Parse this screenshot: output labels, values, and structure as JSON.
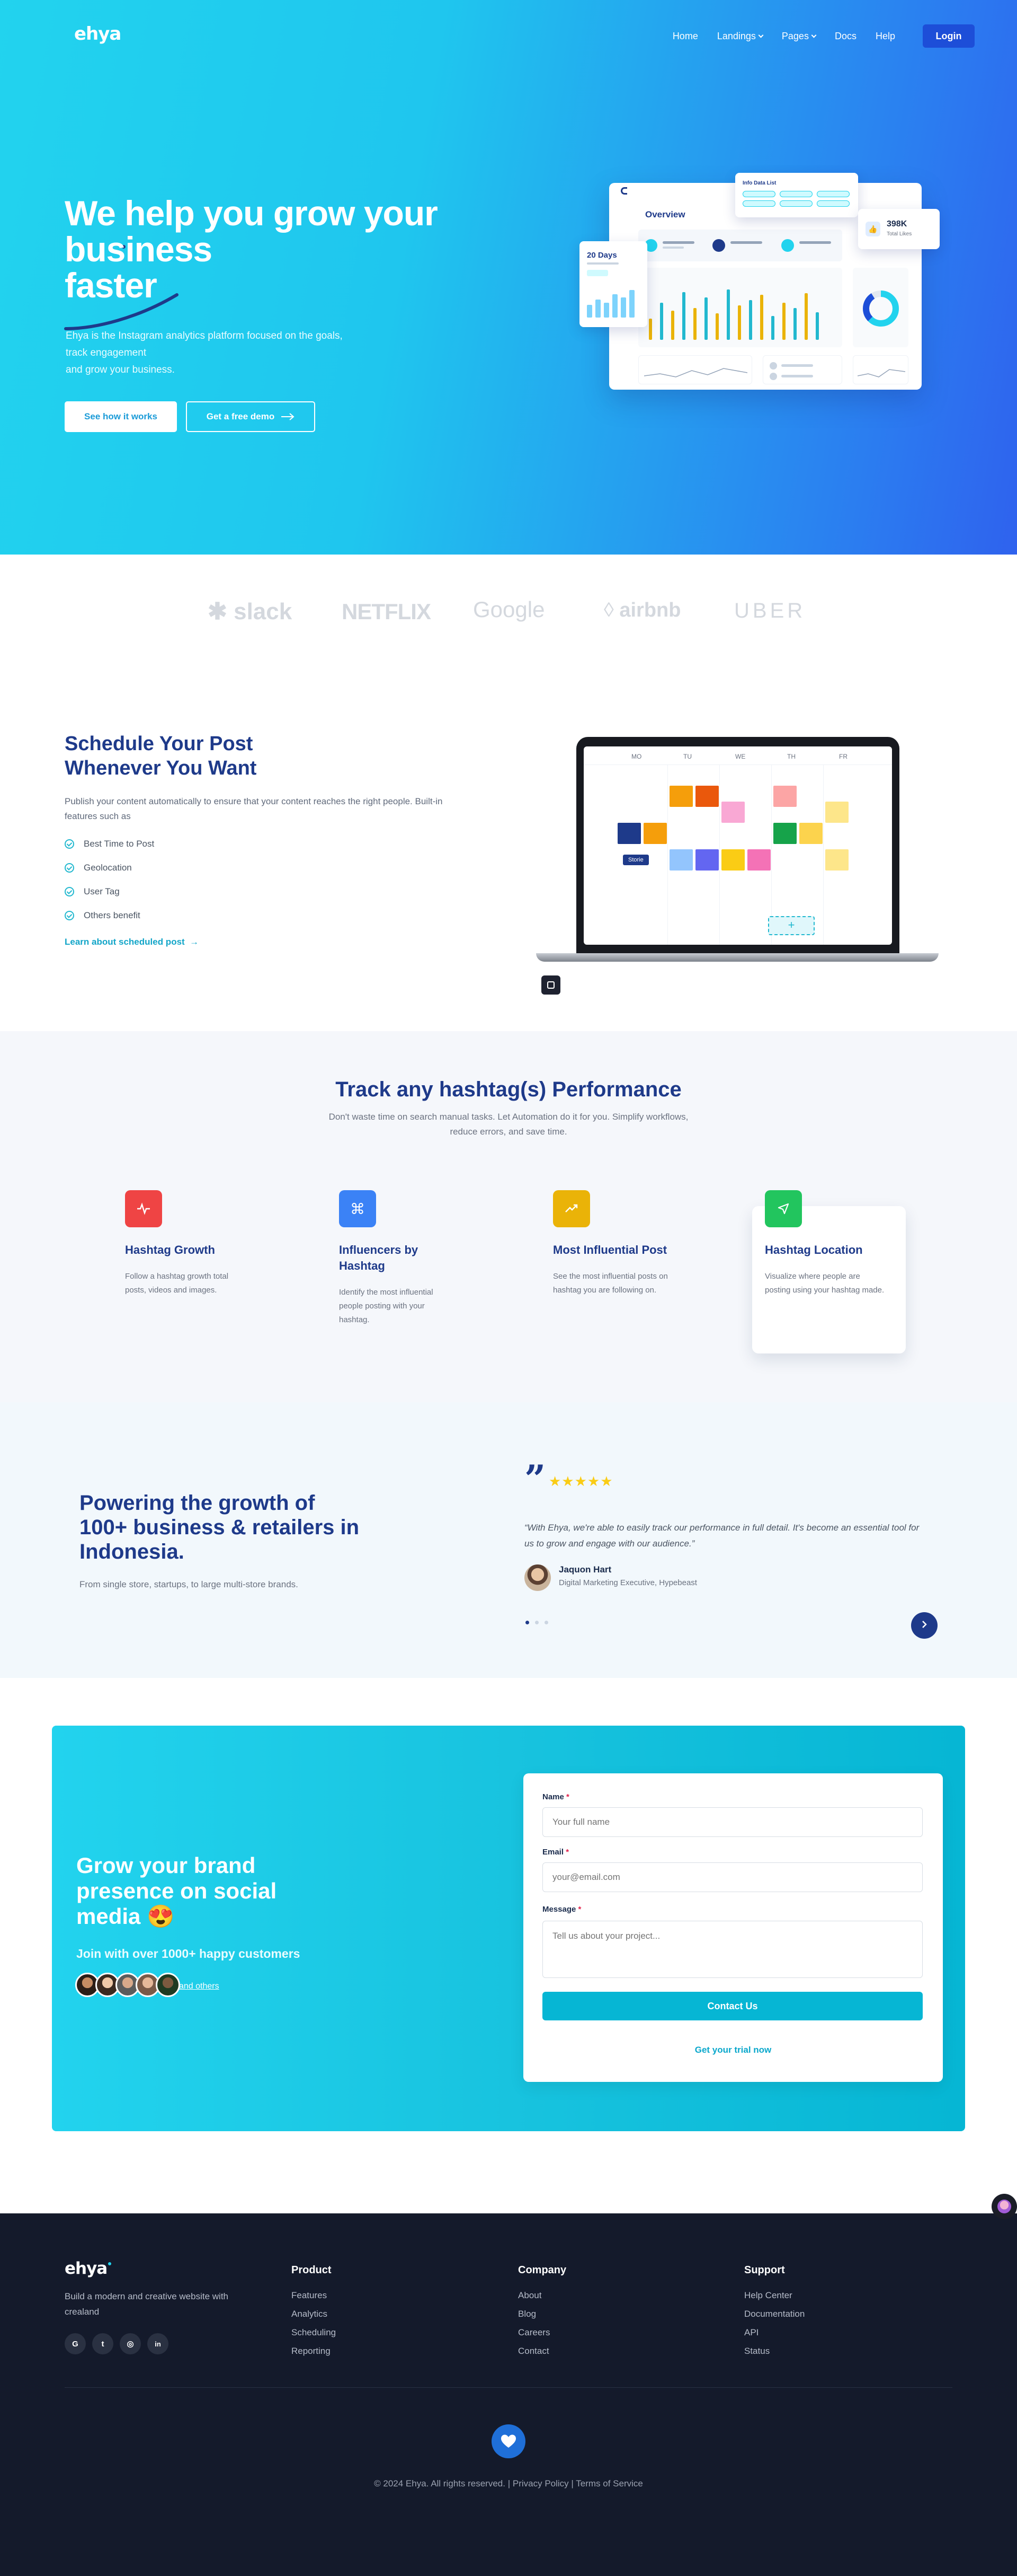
{
  "header": {
    "logo": "ehya",
    "nav": [
      {
        "label": "Home"
      },
      {
        "label": "Landings"
      },
      {
        "label": "Pages"
      },
      {
        "label": "Docs"
      },
      {
        "label": "Help"
      }
    ],
    "login_label": "Login"
  },
  "hero": {
    "title_line1": "We help you grow your",
    "title_line2": "business",
    "title_line3": "faster",
    "desc_line1": "Ehya is the Instagram analytics platform focused on the goals,",
    "desc_line2": "track engagement",
    "desc_line3": "and grow your business.",
    "primary_cta": "See how it works",
    "secondary_cta": "Get a free demo",
    "dashboard": {
      "overview_label": "Overview",
      "days_label": "20 Days",
      "stat_value": "398K",
      "stat_caption": "Total Likes",
      "popup_title": "Info Data List"
    },
    "colors": {
      "gradient_start": "#22d3ee",
      "gradient_end": "#2f62ee",
      "accent": "#1d4ed8"
    }
  },
  "brands": [
    "slack",
    "NETFLIX",
    "Google",
    "airbnb",
    "UBER"
  ],
  "schedule": {
    "title_line1": "Schedule Your Post",
    "title_line2": "Whenever You Want",
    "desc_line1": "Publish your content automatically to ensure that your content reaches the right people. Built-in",
    "desc_line2": "features such as",
    "features": [
      "Best Time to Post",
      "Geolocation",
      "User Tag",
      "Others benefit"
    ],
    "link": "Learn about scheduled post",
    "calendar": {
      "days": [
        "MO",
        "TU",
        "WE",
        "TH",
        "FR"
      ],
      "story_label": "Storie",
      "add_symbol": "+"
    }
  },
  "hashtag": {
    "title": "Track any hashtag(s) Performance",
    "sub_line1": "Don't waste time on search manual tasks. Let Automation do it for you. Simplify workflows,",
    "sub_line2": "reduce errors, and save time.",
    "cards": [
      {
        "title": "Hashtag Growth",
        "desc_lines": [
          "Follow a hashtag growth total",
          "posts, videos and images."
        ],
        "color": "#ef4444"
      },
      {
        "title_lines": [
          "Influencers by",
          "Hashtag"
        ],
        "desc_lines": [
          "Identify the most influential",
          "people posting with your",
          "hashtag."
        ],
        "color": "#3b82f6"
      },
      {
        "title": "Most Influential Post",
        "desc_lines": [
          "See the most influential posts on",
          "hashtag you are following on."
        ],
        "color": "#eab308"
      },
      {
        "title": "Hashtag Location",
        "desc_lines": [
          "Visualize where people are",
          "posting using your hashtag made."
        ],
        "color": "#22c55e"
      }
    ]
  },
  "testimonial": {
    "title_line1": "Powering the growth of",
    "title_line2": "100+ business & retailers in",
    "title_line3": "Indonesia.",
    "sub": "From single store, startups, to large multi-store brands.",
    "quote_mark": "”",
    "stars": "★★★★★",
    "rating": 5,
    "quote_line1": "“With Ehya, we're able to easily track our performance in full detail. It's become an essential tool for",
    "quote_line2": "us to grow and engage with our audience.”",
    "name": "Jaquon Hart",
    "role": "Digital Marketing Executive, Hypebeast"
  },
  "contact": {
    "title_line1": "Grow your brand",
    "title_line2": "presence on social",
    "title_line3": "media",
    "emoji": "😍",
    "join": "Join with over 1000+ happy customers",
    "others_link": "and others",
    "form": {
      "name_label": "Name",
      "name_placeholder": "Your full name",
      "email_label": "Email",
      "email_placeholder": "your@email.com",
      "message_label": "Message",
      "message_placeholder": "Tell us about your project...",
      "required_mark": "*",
      "submit": "Contact Us",
      "trial_link": "Get your trial now"
    }
  },
  "footer": {
    "logo": "ehya",
    "about_line1": "Build a modern and creative website with",
    "about_line2": "crealand",
    "social": [
      {
        "icon": "google-icon",
        "glyph": "G"
      },
      {
        "icon": "twitter-icon",
        "glyph": "t"
      },
      {
        "icon": "instagram-icon",
        "glyph": "◎"
      },
      {
        "icon": "linkedin-icon",
        "glyph": "in"
      }
    ],
    "columns": [
      {
        "title": "Product",
        "links": [
          "Features",
          "Analytics",
          "Scheduling",
          "Reporting"
        ]
      },
      {
        "title": "Company",
        "links": [
          "About",
          "Blog",
          "Careers",
          "Contact"
        ]
      },
      {
        "title": "Support",
        "links": [
          "Help Center",
          "Documentation",
          "API",
          "Status"
        ]
      }
    ],
    "copyright": "© 2024 Ehya. All rights reserved.",
    "privacy": "Privacy Policy",
    "terms": "Terms of Service",
    "separator": "|"
  }
}
